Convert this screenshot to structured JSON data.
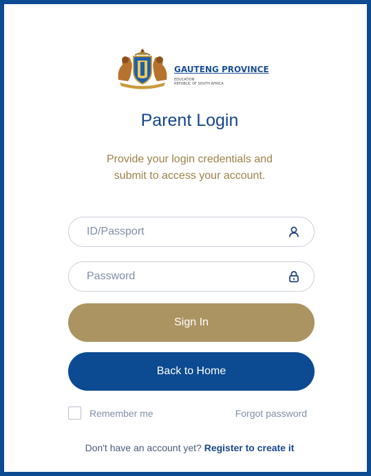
{
  "logo": {
    "brand": "GAUTENG PROVINCE",
    "line1": "EDUCATION",
    "line2": "REPUBLIC OF SOUTH AFRICA"
  },
  "title": "Parent Login",
  "subtitle": {
    "line1": "Provide your login credentials and",
    "line2": "submit to access your account."
  },
  "form": {
    "id_placeholder": "ID/Passport",
    "id_icon": "user-icon",
    "password_placeholder": "Password",
    "password_icon": "lock-icon",
    "signin_label": "Sign In",
    "home_label": "Back to Home",
    "remember_label": "Remember me",
    "forgot_label": "Forgot password"
  },
  "register": {
    "prompt": "Don't have an account yet?",
    "link": "Register to create it"
  },
  "colors": {
    "primary": "#0c4a91",
    "gold": "#ac9462",
    "title": "#15468c"
  }
}
